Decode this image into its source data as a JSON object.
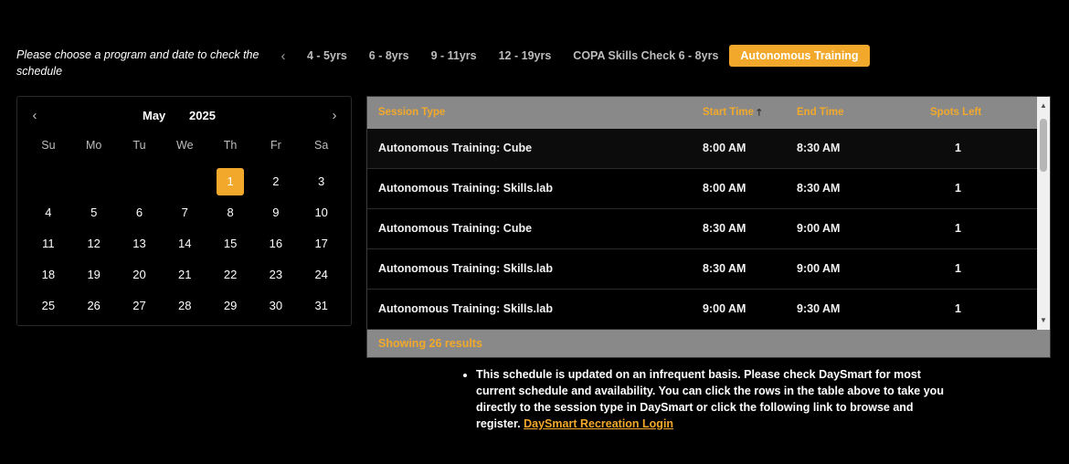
{
  "prompt": "Please choose a program and date to check the schedule",
  "tabs": {
    "prev_icon": "‹",
    "items": [
      {
        "label": "4 - 5yrs"
      },
      {
        "label": "6 - 8yrs"
      },
      {
        "label": "9 - 11yrs"
      },
      {
        "label": "12 - 19yrs"
      },
      {
        "label": "COPA Skills Check 6 - 8yrs"
      },
      {
        "label": "Autonomous Training"
      }
    ],
    "active": "Autonomous Training"
  },
  "calendar": {
    "prev_icon": "‹",
    "next_icon": "›",
    "month": "May",
    "year": "2025",
    "weekdays": [
      "Su",
      "Mo",
      "Tu",
      "We",
      "Th",
      "Fr",
      "Sa"
    ],
    "first_weekday_index": 4,
    "days": [
      "1",
      "2",
      "3",
      "4",
      "5",
      "6",
      "7",
      "8",
      "9",
      "10",
      "11",
      "12",
      "13",
      "14",
      "15",
      "16",
      "17",
      "18",
      "19",
      "20",
      "21",
      "22",
      "23",
      "24",
      "25",
      "26",
      "27",
      "28",
      "29",
      "30",
      "31"
    ],
    "selected_day": "1"
  },
  "table": {
    "headers": {
      "session_type": "Session Type",
      "start_time": "Start Time",
      "sort_icon": "🡑",
      "end_time": "End Time",
      "spots_left": "Spots Left"
    },
    "rows": [
      {
        "session_type": "Autonomous Training: Cube",
        "start_time": "8:00 AM",
        "end_time": "8:30 AM",
        "spots_left": "1"
      },
      {
        "session_type": "Autonomous Training: Skills.lab",
        "start_time": "8:00 AM",
        "end_time": "8:30 AM",
        "spots_left": "1"
      },
      {
        "session_type": "Autonomous Training: Cube",
        "start_time": "8:30 AM",
        "end_time": "9:00 AM",
        "spots_left": "1"
      },
      {
        "session_type": "Autonomous Training: Skills.lab",
        "start_time": "8:30 AM",
        "end_time": "9:00 AM",
        "spots_left": "1"
      },
      {
        "session_type": "Autonomous Training: Skills.lab",
        "start_time": "9:00 AM",
        "end_time": "9:30 AM",
        "spots_left": "1"
      }
    ],
    "footer": "Showing 26 results"
  },
  "notes": {
    "text": "This schedule is updated on an infrequent basis. Please check DaySmart for most current schedule and availability. You can click the rows in the table above to take you directly to the session type in DaySmart or click the following link to browse and register.",
    "link_label": "DaySmart Recreation Login"
  },
  "colors": {
    "accent": "#f2a92b",
    "background": "#000000",
    "table_header": "#898989"
  }
}
